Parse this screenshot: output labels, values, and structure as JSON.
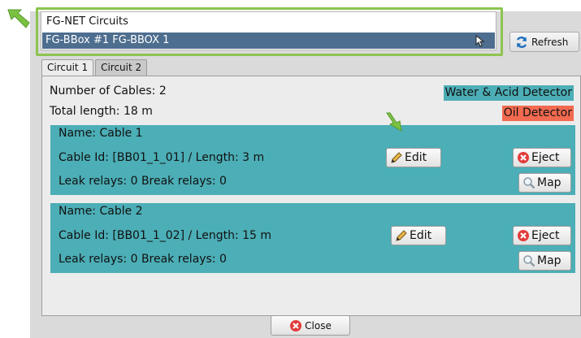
{
  "select": {
    "label": "FG-NET Circuits",
    "selected": "FG-BBox #1 FG-BBOX 1"
  },
  "toolbar": {
    "refresh_label": "Refresh"
  },
  "tabs": [
    {
      "label": "Circuit 1",
      "active": true
    },
    {
      "label": "Circuit 2",
      "active": false
    }
  ],
  "summary": {
    "cables": "Number of Cables: 2",
    "length": "Total length: 18 m"
  },
  "badges": {
    "water": "Water & Acid Detector",
    "oil": "Oil Detector"
  },
  "cables": [
    {
      "name": "Name: Cable 1",
      "id_line": "Cable Id: [BB01_1_01] / Length: 3 m",
      "relays": "Leak relays: 0  Break relays: 0"
    },
    {
      "name": "Name: Cable 2",
      "id_line": "Cable Id: [BB01_1_02] / Length: 15 m",
      "relays": "Leak relays: 0  Break relays: 0"
    }
  ],
  "actions": {
    "edit_label": "Edit",
    "eject_label": "Eject",
    "map_label": "Map"
  },
  "footer": {
    "close_label": "Close"
  },
  "colors": {
    "selection": "#4e6e8f",
    "cable_block": "#4caeb6",
    "water_badge": "#4caeb6",
    "oil_badge": "#f26a4f",
    "highlight": "#8dc44f"
  },
  "icons": {
    "refresh": "refresh-icon",
    "edit": "pencil-icon",
    "eject": "close-circle-icon",
    "map": "magnifier-icon",
    "close": "close-circle-icon",
    "pointer": "green-arrow-icon"
  }
}
